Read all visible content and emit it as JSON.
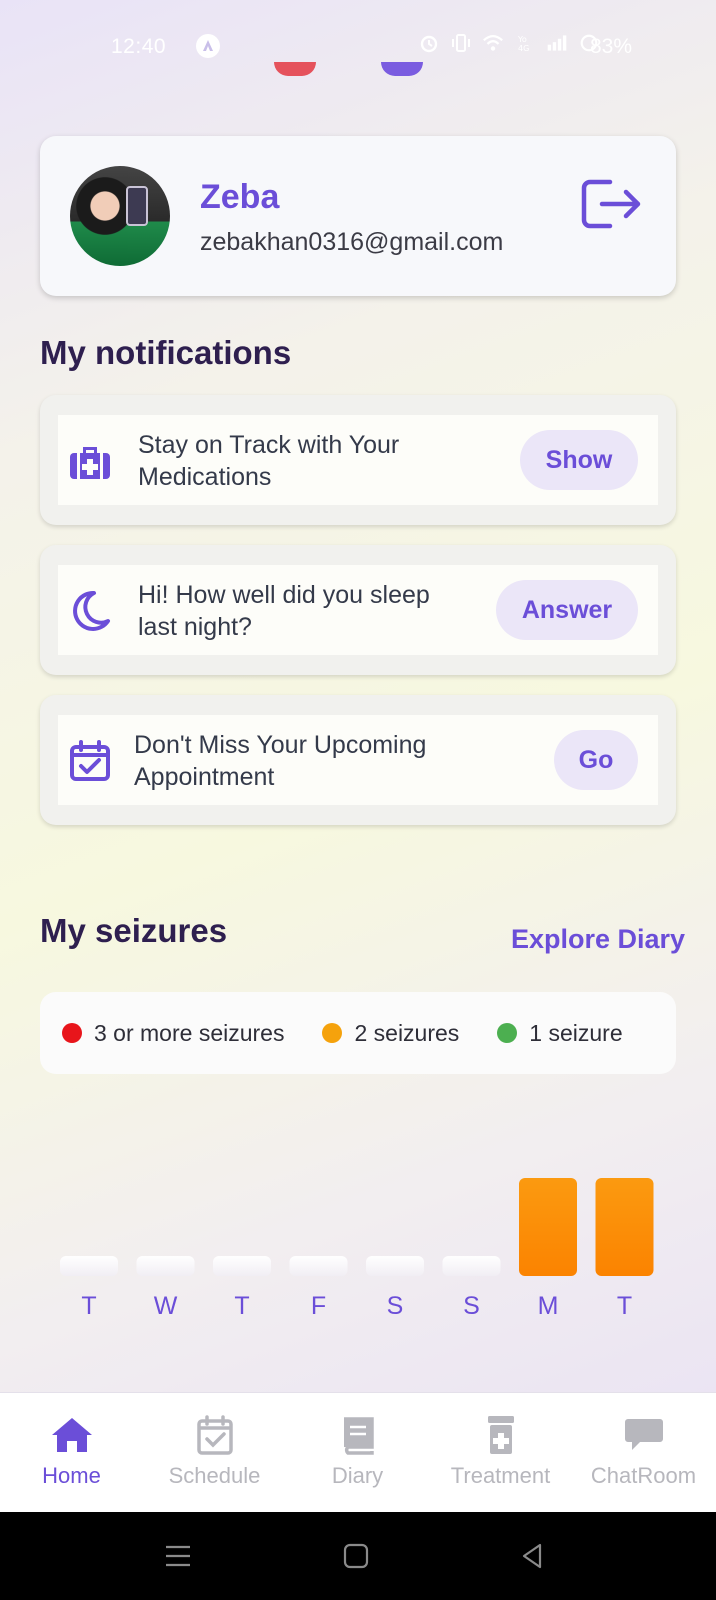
{
  "status_bar": {
    "time": "12:40",
    "battery": "83%",
    "icons": [
      "app-notification-icon",
      "alarm-icon",
      "vibrate-icon",
      "wifi-icon",
      "volte-icon",
      "signal-icon",
      "battery-icon"
    ]
  },
  "profile": {
    "name": "Zeba",
    "email": "zebakhan0316@gmail.com",
    "avatar_icon": "user-photo",
    "logout_icon": "logout-icon"
  },
  "notifications": {
    "title": "My notifications",
    "items": [
      {
        "text": "Stay on Track with Your Medications",
        "button": "Show",
        "icon": "medical-kit-icon"
      },
      {
        "text": "Hi! How well did you sleep last night?",
        "button": "Answer",
        "icon": "moon-icon"
      },
      {
        "text": "Don't Miss Your Upcoming Appointment",
        "button": "Go",
        "icon": "calendar-check-icon"
      }
    ]
  },
  "seizures": {
    "title": "My seizures",
    "explore_link": "Explore Diary",
    "legend": [
      {
        "label": "3 or more seizures",
        "color": "#e8151b"
      },
      {
        "label": "2 seizures",
        "color": "#f5a20c"
      },
      {
        "label": "1 seizure",
        "color": "#4caf50"
      }
    ]
  },
  "chart_data": {
    "type": "bar",
    "categories": [
      "T",
      "W",
      "T",
      "F",
      "S",
      "S",
      "M",
      "T"
    ],
    "values": [
      0,
      0,
      0,
      0,
      0,
      0,
      2,
      2
    ],
    "colors": {
      "0": "#ffffff",
      "1": "#4caf50",
      "2": "#fb8c00",
      "3": "#e8151b"
    },
    "xlabel": "",
    "ylabel": "",
    "ylim": [
      0,
      3
    ],
    "grid": false
  },
  "bottom_nav": [
    {
      "label": "Home",
      "icon": "home-icon",
      "active": true
    },
    {
      "label": "Schedule",
      "icon": "calendar-check-icon",
      "active": false
    },
    {
      "label": "Diary",
      "icon": "book-icon",
      "active": false
    },
    {
      "label": "Treatment",
      "icon": "pill-bottle-icon",
      "active": false
    },
    {
      "label": "ChatRoom",
      "icon": "chat-bubble-icon",
      "active": false
    }
  ],
  "colors": {
    "accent": "#6b4ed8",
    "heading": "#2e1f4f",
    "nav_inactive": "#b7b7bd"
  }
}
